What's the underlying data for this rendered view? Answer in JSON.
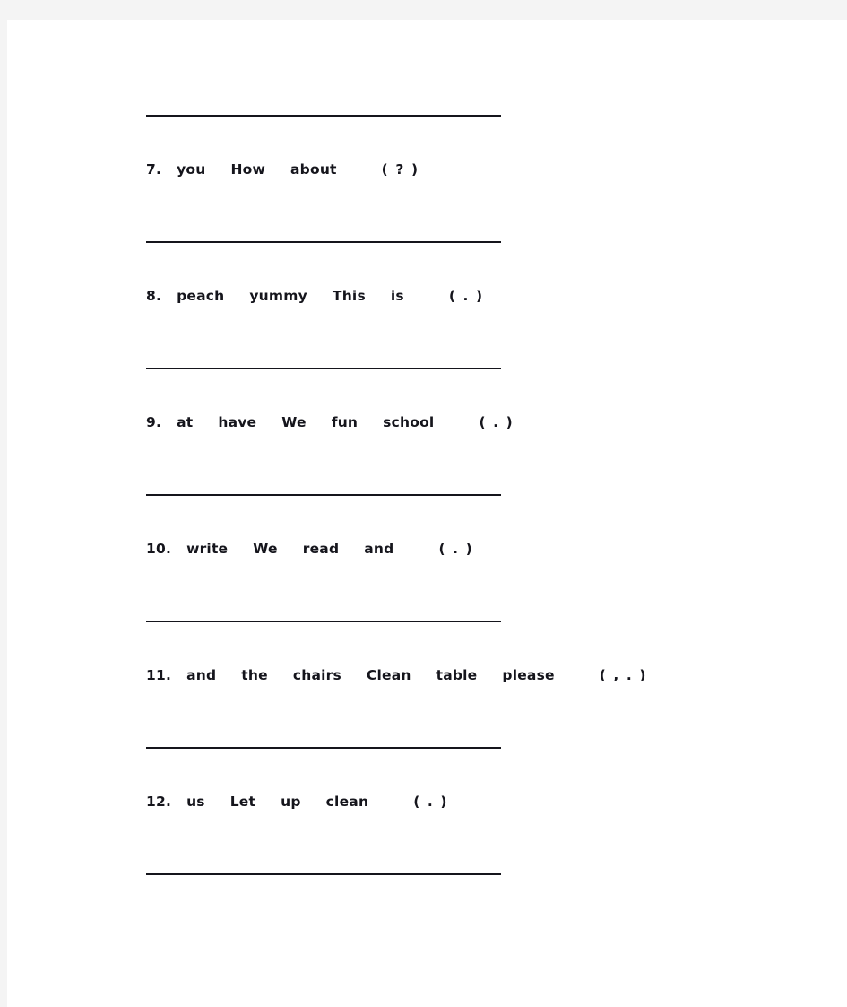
{
  "page": {
    "background_color": "#f4f4f4",
    "sheet_color": "#ffffff",
    "text_color": "#15151c"
  },
  "worksheet": {
    "top_answer_line_label": "answer-line",
    "items": [
      {
        "number": "7.",
        "words": [
          "you",
          "How",
          "about"
        ],
        "punctuation_hint": "( ? )"
      },
      {
        "number": "8.",
        "words": [
          "peach",
          "yummy",
          "This",
          "is"
        ],
        "punctuation_hint": "( . )"
      },
      {
        "number": "9.",
        "words": [
          "at",
          "have",
          "We",
          "fun",
          "school"
        ],
        "punctuation_hint": "( . )"
      },
      {
        "number": "10.",
        "words": [
          "write",
          "We",
          "read",
          "and"
        ],
        "punctuation_hint": "( . )"
      },
      {
        "number": "11.",
        "words": [
          "and",
          "the",
          "chairs",
          "Clean",
          "table",
          "please"
        ],
        "punctuation_hint": "( , . )"
      },
      {
        "number": "12.",
        "words": [
          "us",
          "Let",
          "up",
          "clean"
        ],
        "punctuation_hint": "( . )"
      }
    ]
  }
}
